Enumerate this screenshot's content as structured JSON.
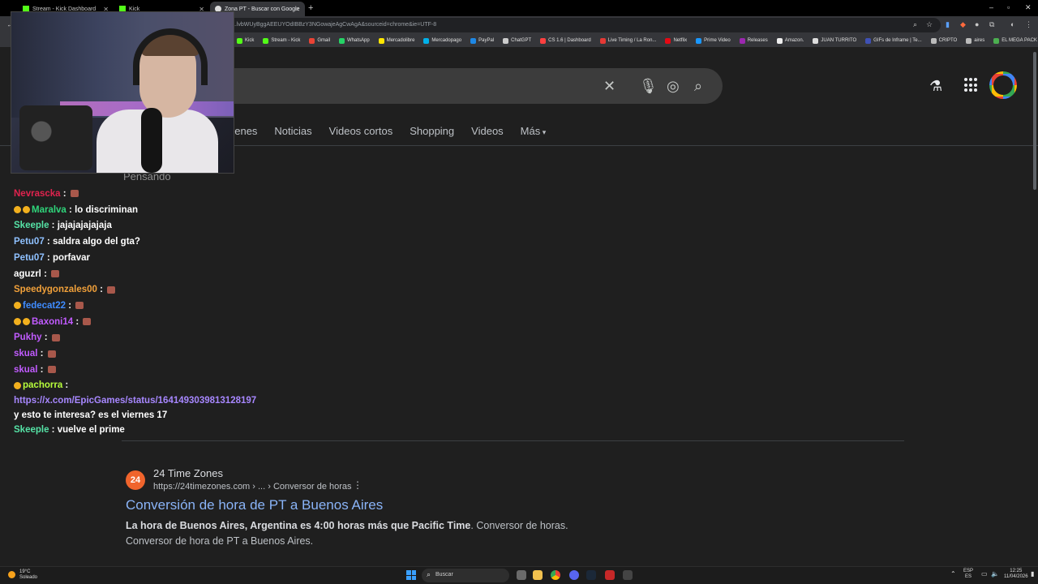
{
  "browser": {
    "tabs": [
      {
        "title": "Stream - Kick Dashboard"
      },
      {
        "title": "Kick"
      },
      {
        "title": "Zona PT - Buscar con Google"
      }
    ],
    "new_tab": "+",
    "url": "...lvbWUyBggAEEUYOdIBBzY3NGowajeAgCwAgA&sourceid=chrome&ie=UTF-8",
    "bookmarks": [
      {
        "label": "Kick",
        "color": "#53fc18"
      },
      {
        "label": "Stream - Kick",
        "color": "#53fc18"
      },
      {
        "label": "Gmail",
        "color": "#ea4335"
      },
      {
        "label": "WhatsApp",
        "color": "#25d366"
      },
      {
        "label": "Mercadolibre",
        "color": "#ffe600"
      },
      {
        "label": "Mercadopago",
        "color": "#00b1ea"
      },
      {
        "label": "PayPal",
        "color": "#1e88e5"
      },
      {
        "label": "ChatGPT",
        "color": "#cccccc"
      },
      {
        "label": "CS 1.6 | Dashboard",
        "color": "#ff4040"
      },
      {
        "label": "Live Timing / La Ron...",
        "color": "#e53935"
      },
      {
        "label": "Netflix",
        "color": "#e50914"
      },
      {
        "label": "Prime Video",
        "color": "#1a98ff"
      },
      {
        "label": "Releases",
        "color": "#9c27b0"
      },
      {
        "label": "Amazon.",
        "color": "#eeeeee"
      },
      {
        "label": "JUAN TURRITO",
        "color": "#dddddd"
      },
      {
        "label": "GIFs de Inframe | Te...",
        "color": "#3f51b5"
      },
      {
        "label": "CRIPTO",
        "color": "#bbbbbb"
      },
      {
        "label": "aires",
        "color": "#bbbbbb"
      },
      {
        "label": "EL MEGA PACK PAP...",
        "color": "#4caf50"
      }
    ]
  },
  "google": {
    "tabs": [
      "genes",
      "Noticias",
      "Videos cortos",
      "Shopping",
      "Videos",
      "Más"
    ],
    "thinking": "Pensando",
    "result": {
      "favicon_text": "24",
      "site": "24 Time Zones",
      "url": "https://24timezones.com › ... › Conversor de horas",
      "title": "Conversión de hora de PT a Buenos Aires",
      "snippet_bold": "La hora de Buenos Aires, Argentina es 4:00 horas más que Pacific Time",
      "snippet_rest": ". Conversor de horas. Conversor de hora de PT a Buenos Aires."
    }
  },
  "chat": [
    {
      "user": "Nevrascka",
      "color": "#e0234e",
      "text": "",
      "emote": true
    },
    {
      "user": "Maralva",
      "color": "#2fd67b",
      "text": "lo discriminan",
      "badges": 2
    },
    {
      "user": "Skeeple",
      "color": "#55e3a6",
      "text": "jajajajajajaja"
    },
    {
      "user": "Petu07",
      "color": "#8fc1ff",
      "text": "saldra algo del gta?"
    },
    {
      "user": "Petu07",
      "color": "#8fc1ff",
      "text": "porfavar"
    },
    {
      "user": "aguzrl",
      "color": "#ffffff",
      "text": "",
      "emote": true
    },
    {
      "user": "Speedygonzales00",
      "color": "#f2a13a",
      "text": "",
      "emote": true
    },
    {
      "user": "fedecat22",
      "color": "#3f8cff",
      "text": "",
      "emote": true,
      "badges": 1
    },
    {
      "user": "Baxoni14",
      "color": "#c15bff",
      "text": "",
      "emote": true,
      "badges": 2
    },
    {
      "user": "Pukhy",
      "color": "#c15bff",
      "text": "",
      "emote": true
    },
    {
      "user": "skual",
      "color": "#c15bff",
      "text": "",
      "emote": true
    },
    {
      "user": "skual",
      "color": "#c15bff",
      "text": "",
      "emote": true
    },
    {
      "user": "pachorra",
      "color": "#b8ff3c",
      "text": "",
      "badges": 1
    },
    {
      "link": "https://x.com/EpicGames/status/1641493039813128197",
      "text": " y esto te interesa? es el viernes 17"
    },
    {
      "user": "Skeeple",
      "color": "#55e3a6",
      "text": "vuelve el prime"
    }
  ],
  "taskbar": {
    "weather_temp": "19°C",
    "weather_desc": "Soleado",
    "search_placeholder": "Buscar",
    "lang_top": "ESP",
    "lang_bottom": "ES",
    "time": "12:25",
    "date": "11/04/2026"
  }
}
